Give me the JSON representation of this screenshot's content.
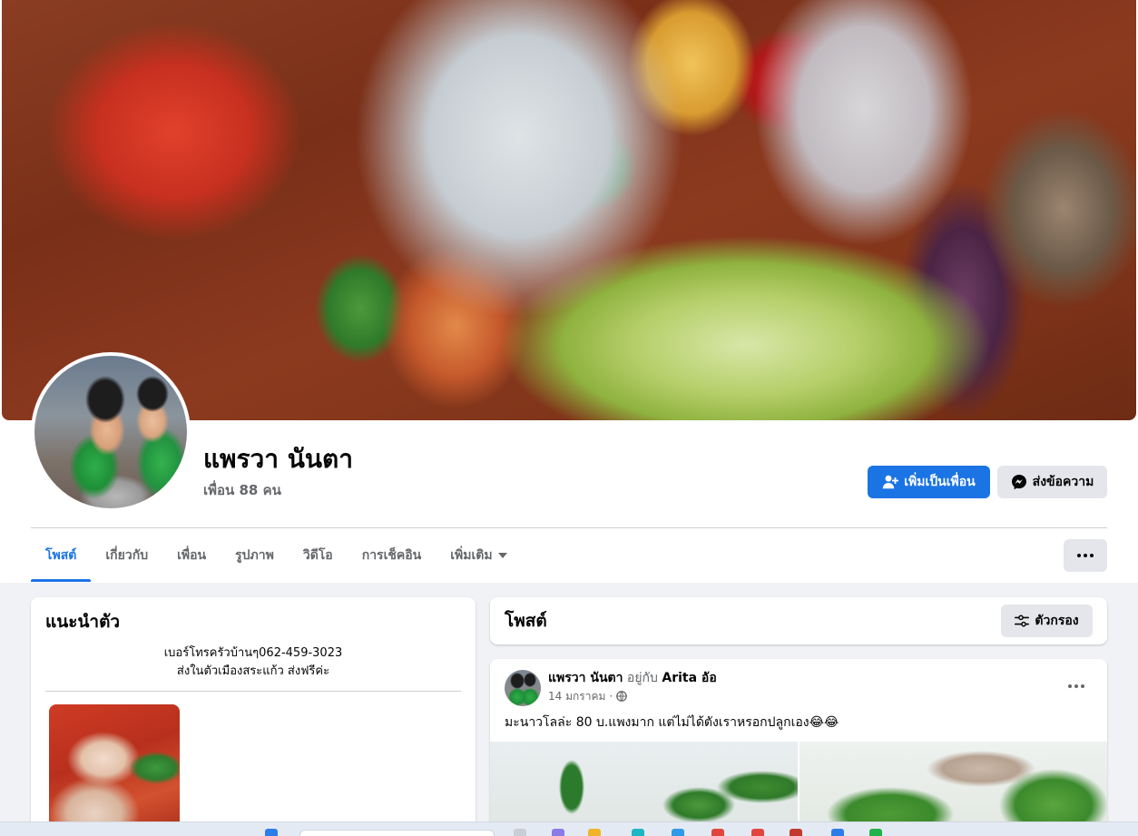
{
  "profile": {
    "name": "แพรวา นันตา",
    "friends_count": "เพื่อน 88 คน",
    "add_friend_label": "เพิ่มเป็นเพื่อน",
    "message_label": "ส่งข้อความ"
  },
  "tabs": [
    {
      "label": "โพสต์",
      "active": true
    },
    {
      "label": "เกี่ยวกับ",
      "active": false
    },
    {
      "label": "เพื่อน",
      "active": false
    },
    {
      "label": "รูปภาพ",
      "active": false
    },
    {
      "label": "วิดีโอ",
      "active": false
    },
    {
      "label": "การเช็คอิน",
      "active": false
    },
    {
      "label": "เพิ่มเติม",
      "active": false
    }
  ],
  "intro": {
    "title": "แนะนำตัว",
    "bio_line1": "เบอร์โทรครัวบ้านๆ062-459-3023",
    "bio_line2": "ส่งในตัวเมืองสระแก้ว ส่งฟรีค่ะ"
  },
  "posts_section": {
    "title": "โพสต์",
    "filter_label": "ตัวกรอง"
  },
  "post": {
    "author": "แพรวา นันตา",
    "with_text": "อยู่กับ",
    "tagged": "Arita อัอ",
    "date": "14 มกราคม",
    "separator": "·",
    "text": "มะนาวโลล่ะ 80 บ.แพงมาก แต่ไม่ได้ตังเราหรอกปลูกเอง😂😂"
  },
  "colors": {
    "accent": "#1b74e4",
    "page_bg": "#f0f2f5",
    "secondary_btn": "#e4e6eb",
    "muted_text": "#65676b"
  },
  "icons": {
    "add_friend": "person-plus-icon",
    "messenger": "messenger-icon",
    "filter": "sliders-icon",
    "privacy": "globe-icon",
    "more": "ellipsis-icon",
    "dropdown": "caret-down-icon"
  }
}
